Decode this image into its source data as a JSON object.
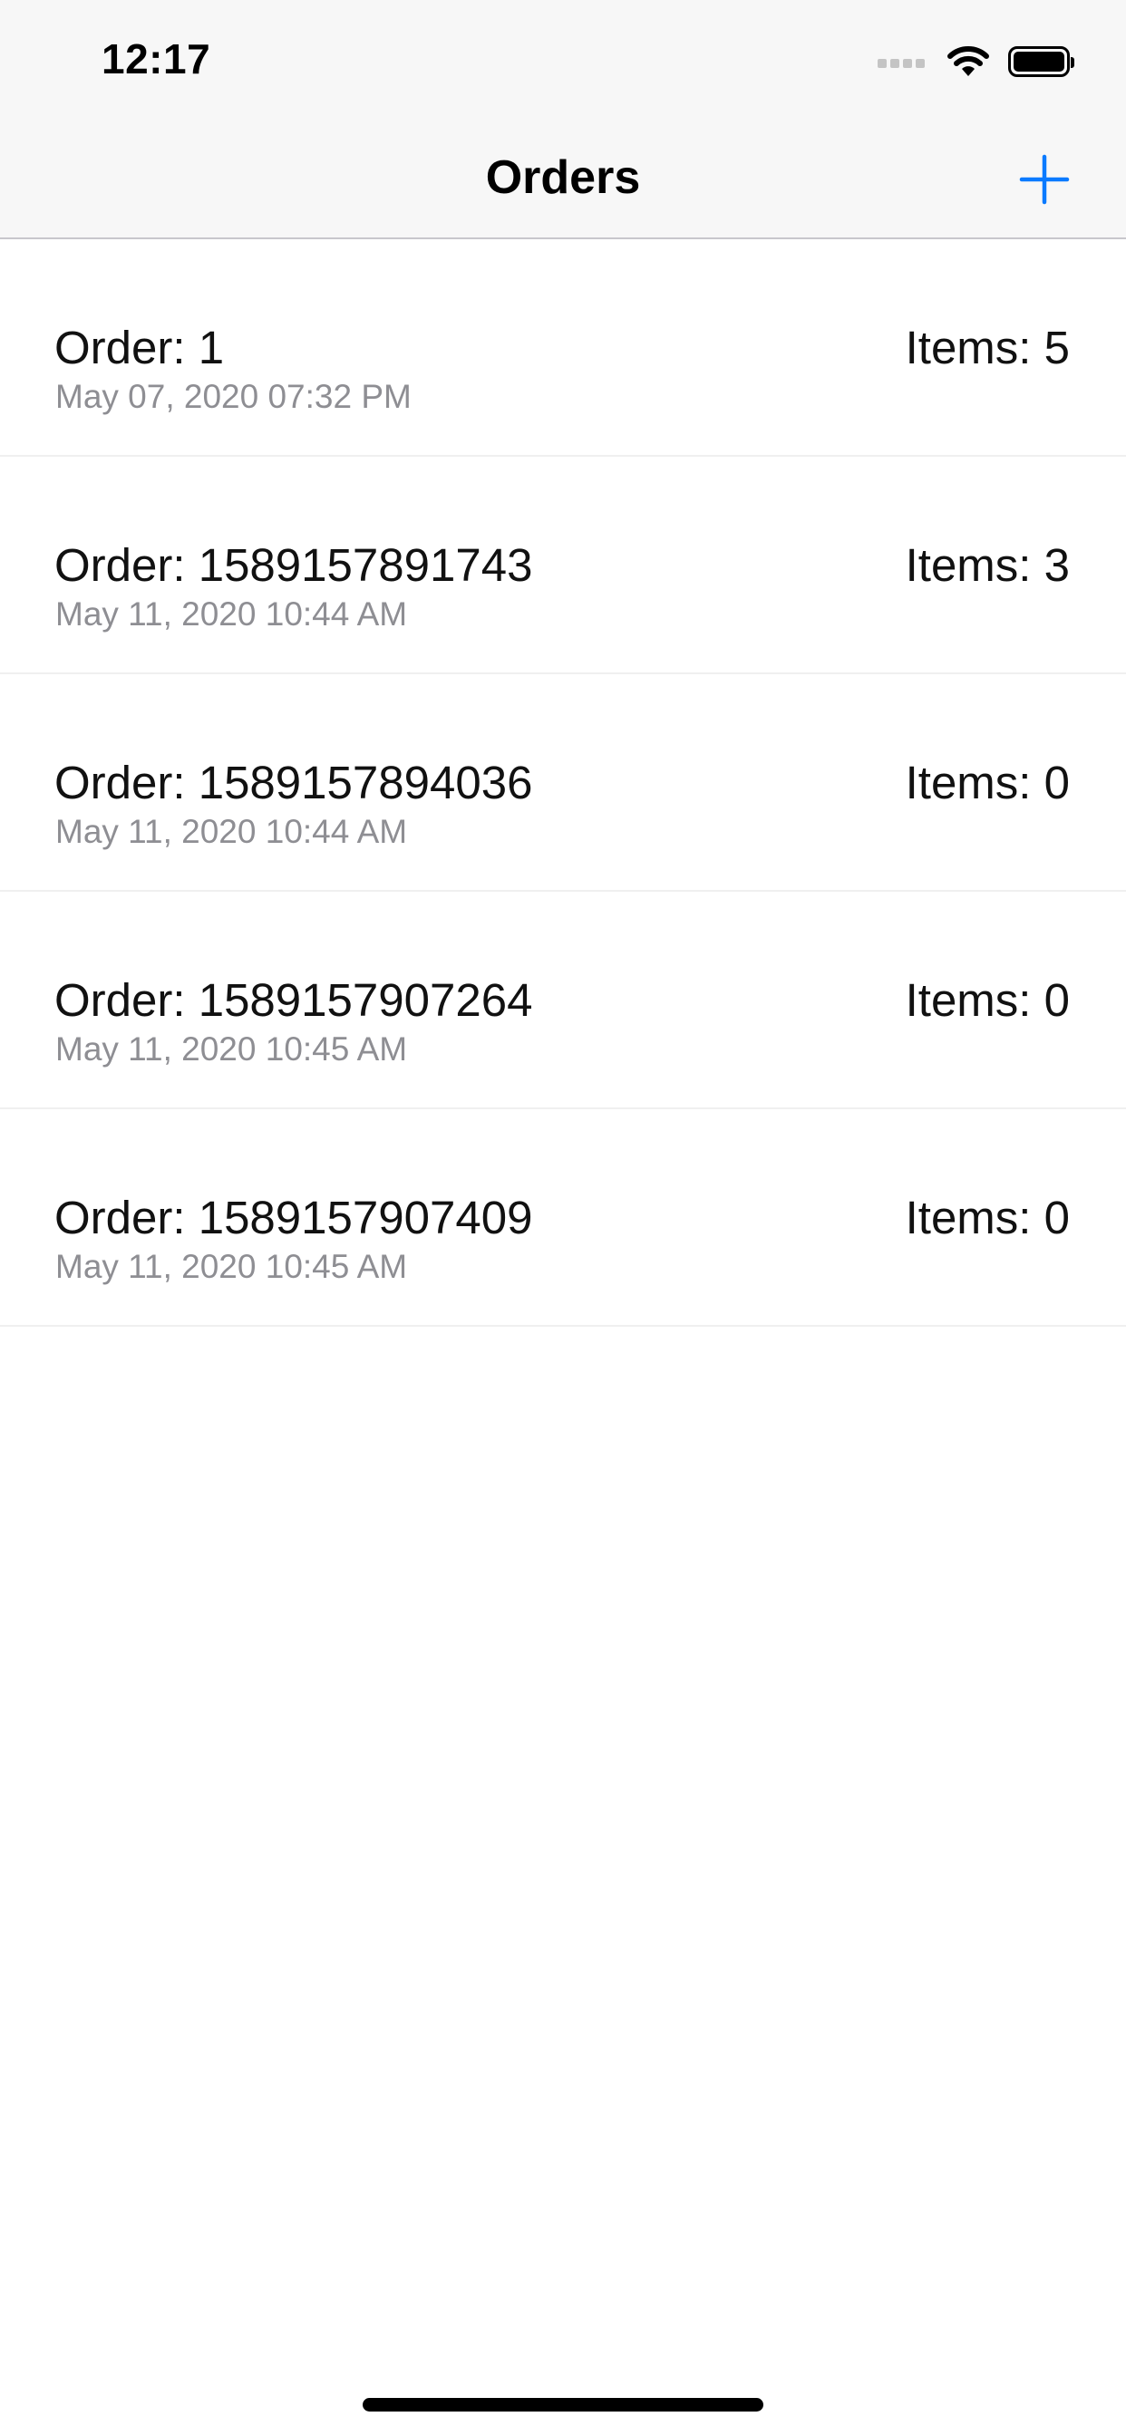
{
  "status_bar": {
    "time": "12:17",
    "icons": [
      "cellular-signal-icon",
      "wifi-icon",
      "battery-icon"
    ]
  },
  "nav": {
    "title": "Orders",
    "add_icon": "plus-icon",
    "accent_color": "#0a7aff"
  },
  "orders": [
    {
      "title": "Order: 1",
      "date": "May 07, 2020 07:32 PM",
      "items": "Items: 5"
    },
    {
      "title": "Order: 1589157891743",
      "date": "May 11, 2020 10:44 AM",
      "items": "Items: 3"
    },
    {
      "title": "Order: 1589157894036",
      "date": "May 11, 2020 10:44 AM",
      "items": "Items: 0"
    },
    {
      "title": "Order: 1589157907264",
      "date": "May 11, 2020 10:45 AM",
      "items": "Items: 0"
    },
    {
      "title": "Order: 1589157907409",
      "date": "May 11, 2020 10:45 AM",
      "items": "Items: 0"
    }
  ]
}
